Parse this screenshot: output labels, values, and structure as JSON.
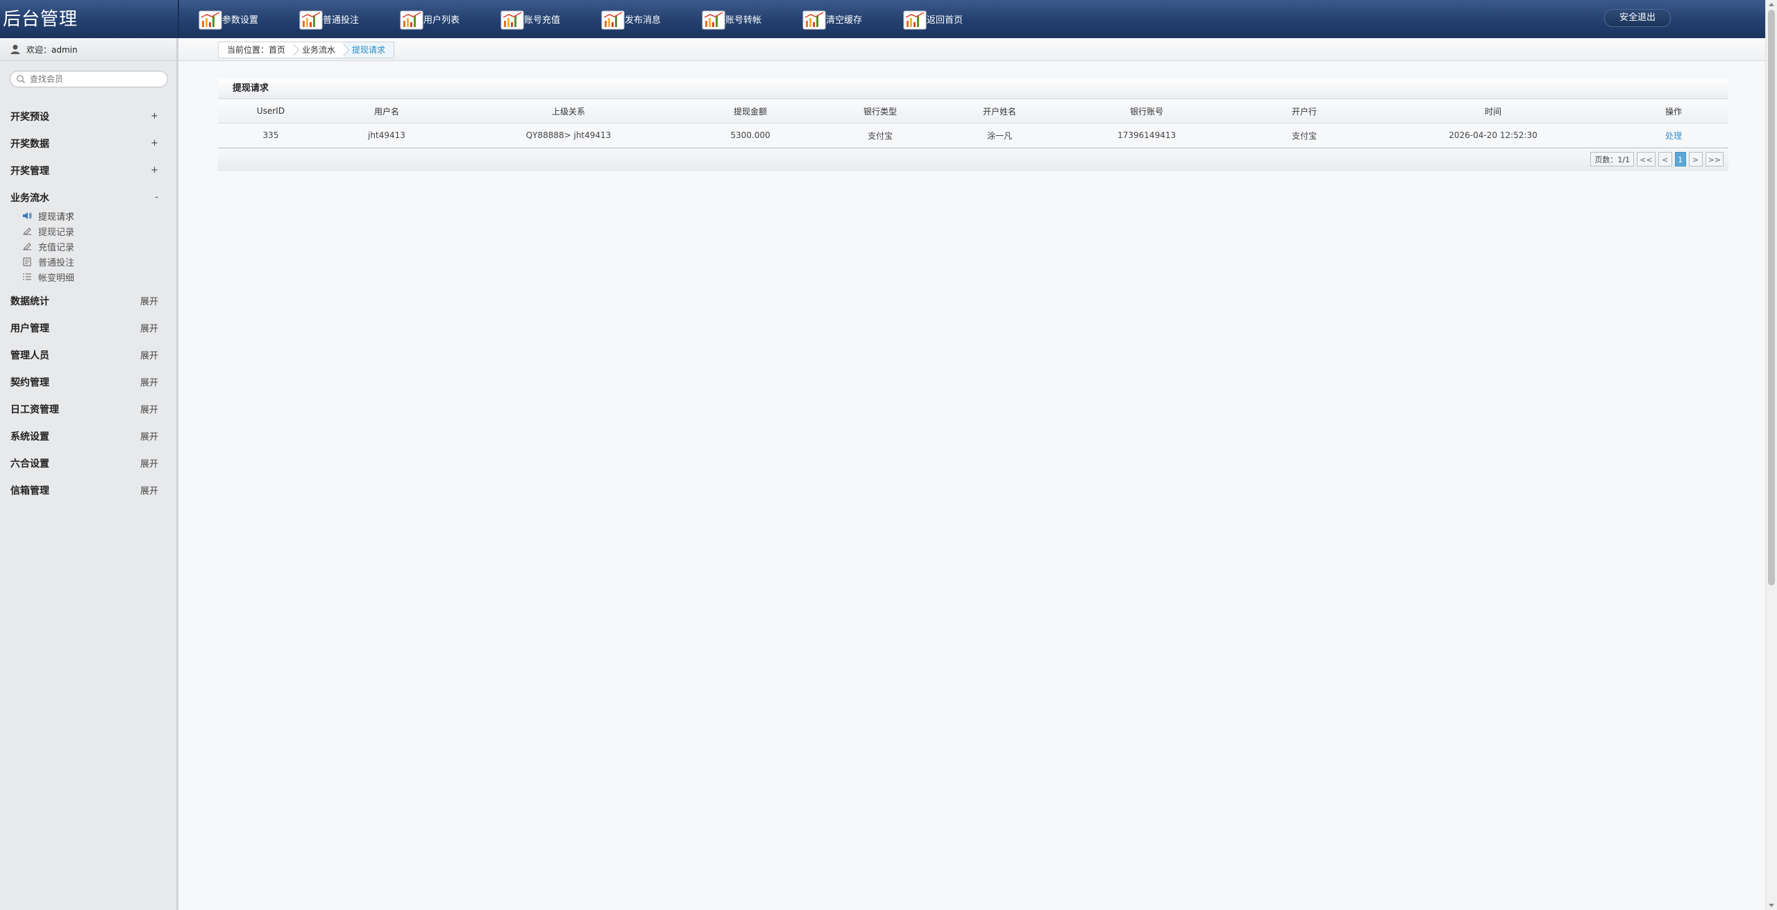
{
  "brand": "后台管理",
  "topnav": [
    {
      "label": "参数设置",
      "icon": "chart-icon"
    },
    {
      "label": "普通投注",
      "icon": "chart-icon"
    },
    {
      "label": "用户列表",
      "icon": "chart-icon"
    },
    {
      "label": "账号充值",
      "icon": "chart-icon"
    },
    {
      "label": "发布消息",
      "icon": "chart-icon"
    },
    {
      "label": "账号转帐",
      "icon": "chart-icon"
    },
    {
      "label": "清空缓存",
      "icon": "chart-icon"
    },
    {
      "label": "返回首页",
      "icon": "chart-icon"
    }
  ],
  "logout": "安全退出",
  "sidebar": {
    "welcome": "欢迎：admin",
    "search_placeholder": "查找会员",
    "groups": [
      {
        "title": "开奖预设",
        "state": "+"
      },
      {
        "title": "开奖数据",
        "state": "+"
      },
      {
        "title": "开奖管理",
        "state": "+"
      },
      {
        "title": "业务流水",
        "state": "-"
      },
      {
        "title": "数据统计",
        "state": "展开"
      },
      {
        "title": "用户管理",
        "state": "展开"
      },
      {
        "title": "管理人员",
        "state": "展开"
      },
      {
        "title": "契约管理",
        "state": "展开"
      },
      {
        "title": "日工资管理",
        "state": "展开"
      },
      {
        "title": "系统设置",
        "state": "展开"
      },
      {
        "title": "六合设置",
        "state": "展开"
      },
      {
        "title": "信箱管理",
        "state": "展开"
      }
    ],
    "sub_items": [
      {
        "label": "提现请求",
        "icon": "speaker-icon"
      },
      {
        "label": "提现记录",
        "icon": "edit-icon"
      },
      {
        "label": "充值记录",
        "icon": "edit-icon"
      },
      {
        "label": "普通投注",
        "icon": "book-icon"
      },
      {
        "label": "帐变明细",
        "icon": "list-icon"
      }
    ]
  },
  "breadcrumb": {
    "items": [
      "当前位置：首页",
      "业务流水",
      "提现请求"
    ]
  },
  "panel": {
    "title": "提现请求",
    "columns": [
      "UserID",
      "用户名",
      "上级关系",
      "提现金额",
      "银行类型",
      "开户姓名",
      "银行账号",
      "开户行",
      "时间",
      "操作"
    ],
    "rows": [
      [
        "335",
        "jht49413",
        "QY88888> jht49413",
        "5300.000",
        "支付宝",
        "涂一凡",
        "17396149413",
        "支付宝",
        "2026-04-20 12:52:30",
        "处理"
      ]
    ]
  },
  "pager": {
    "info": "页数：1/1",
    "first": "<<",
    "prev": "<",
    "current": "1",
    "next": ">",
    "last": ">>"
  },
  "colors": {
    "topbar": "#23406f",
    "accent": "#2a8bc8",
    "link": "#3a8fd0",
    "pager_current": "#5ca6d6"
  }
}
